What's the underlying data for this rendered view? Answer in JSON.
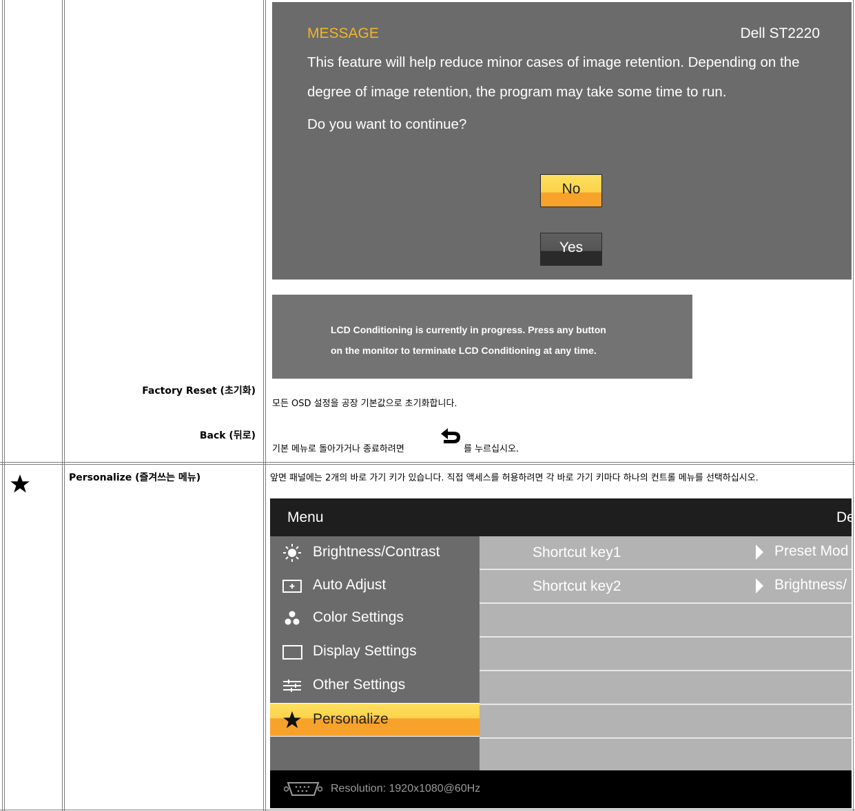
{
  "message_dialog": {
    "title": "MESSAGE",
    "model": "Dell ST2220",
    "line1": "This feature will help reduce minor cases of image retention. Depending on the",
    "line2": "degree of image retention, the program may take some time to run.",
    "line3": "Do you want to continue?",
    "no_label": "No",
    "yes_label": "Yes",
    "colors": {
      "background": "#6b6b6b",
      "title": "#f2b628",
      "highlight": "#f7a22a"
    }
  },
  "progress_message": {
    "line1": "LCD Conditioning is currently in progress. Press any button",
    "line2": "on the monitor to terminate LCD Conditioning at any time."
  },
  "rows": [
    {
      "label": "Factory Reset (초기화)",
      "description": "모든 OSD 설정을 공장 기본값으로 초기화합니다."
    },
    {
      "label": "Back (뒤로)",
      "description_before": "기본 메뉴로 돌아가거나 종료하려면",
      "icon": "back-arrow-icon",
      "description_after": "를 누르십시오."
    },
    {
      "icon": "star-icon",
      "label": "Personalize (즐겨쓰는 메뉴)",
      "description": "앞면 패널에는 2개의 바로 가기 키가 있습니다. 직접 액세스를 허용하려면 각 바로 가기 키마다 하나의 컨트롤 메뉴를 선택하십시오."
    }
  ],
  "osd_menu": {
    "title": "Menu",
    "brand_fragment": "De",
    "items": [
      {
        "label": "Brightness/Contrast",
        "icon": "brightness-icon"
      },
      {
        "label": "Auto Adjust",
        "icon": "auto-adjust-icon"
      },
      {
        "label": "Color Settings",
        "icon": "color-settings-icon"
      },
      {
        "label": "Display Settings",
        "icon": "display-settings-icon"
      },
      {
        "label": "Other Settings",
        "icon": "other-settings-icon"
      },
      {
        "label": "Personalize",
        "icon": "star-icon",
        "selected": true
      }
    ],
    "shortcuts": [
      {
        "key": "Shortcut key1",
        "value": "Preset Mod"
      },
      {
        "key": "Shortcut key2",
        "value": "Brightness/"
      }
    ],
    "resolution": "Resolution:  1920x1080@60Hz"
  }
}
